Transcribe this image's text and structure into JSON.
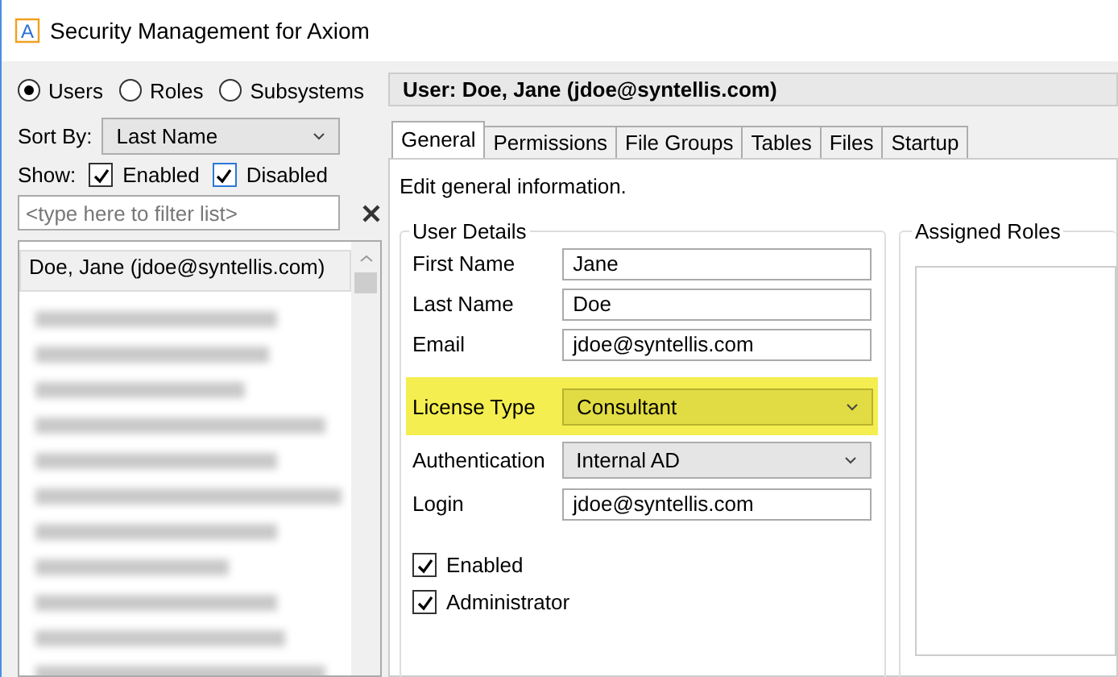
{
  "window": {
    "logo_letter": "A",
    "title": "Security Management for Axiom"
  },
  "view_options": [
    {
      "label": "Users",
      "selected": true
    },
    {
      "label": "Roles",
      "selected": false
    },
    {
      "label": "Subsystems",
      "selected": false
    }
  ],
  "sort_by": {
    "label": "Sort By:",
    "value": "Last Name"
  },
  "show": {
    "label": "Show:",
    "options": [
      {
        "label": "Enabled",
        "checked": true,
        "focused": false
      },
      {
        "label": "Disabled",
        "checked": true,
        "focused": true
      }
    ]
  },
  "filter": {
    "placeholder": "<type here to filter list>"
  },
  "user_list": {
    "items": [
      {
        "label": "Doe, Jane (jdoe@syntellis.com)",
        "selected": true
      }
    ]
  },
  "header": "User: Doe, Jane (jdoe@syntellis.com)",
  "tabs": [
    {
      "label": "General",
      "selected": true
    },
    {
      "label": "Permissions",
      "selected": false
    },
    {
      "label": "File Groups",
      "selected": false
    },
    {
      "label": "Tables",
      "selected": false
    },
    {
      "label": "Files",
      "selected": false
    },
    {
      "label": "Startup",
      "selected": false
    }
  ],
  "description": "Edit general information.",
  "user_details": {
    "title": "User Details",
    "fields": [
      {
        "label": "First Name",
        "value": "Jane",
        "kind": "text",
        "highlighted": false
      },
      {
        "label": "Last Name",
        "value": "Doe",
        "kind": "text",
        "highlighted": false
      },
      {
        "label": "Email",
        "value": "jdoe@syntellis.com",
        "kind": "text",
        "highlighted": false
      },
      {
        "label": "License Type",
        "value": "Consultant",
        "kind": "dropdown",
        "highlighted": true
      },
      {
        "label": "Authentication",
        "value": "Internal AD",
        "kind": "dropdown",
        "highlighted": false
      },
      {
        "label": "Login",
        "value": "jdoe@syntellis.com",
        "kind": "text",
        "highlighted": false
      }
    ],
    "checkboxes": [
      {
        "label": "Enabled",
        "checked": true
      },
      {
        "label": "Administrator",
        "checked": true
      }
    ]
  },
  "assigned_roles": {
    "title": "Assigned Roles"
  }
}
